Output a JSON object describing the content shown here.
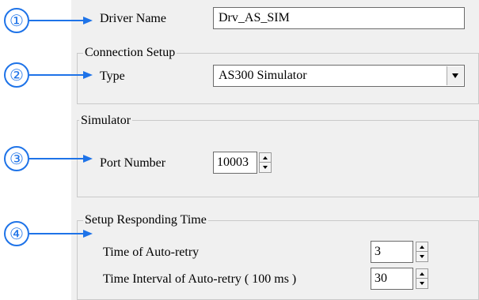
{
  "driver_name": {
    "label": "Driver Name",
    "value": "Drv_AS_SIM"
  },
  "connection_setup": {
    "title": "Connection Setup",
    "type_label": "Type",
    "type_value": "AS300 Simulator"
  },
  "simulator": {
    "title": "Simulator",
    "port_label": "Port Number",
    "port_value": "10003"
  },
  "responding_time": {
    "title": "Setup Responding Time",
    "auto_retry_label": "Time of Auto-retry",
    "auto_retry_value": "3",
    "interval_label": "Time Interval of Auto-retry ( 100 ms )",
    "interval_value": "30"
  },
  "callouts": [
    "①",
    "②",
    "③",
    "④"
  ],
  "colors": {
    "callout": "#1e73e8",
    "panel": "#f0f0f0"
  }
}
